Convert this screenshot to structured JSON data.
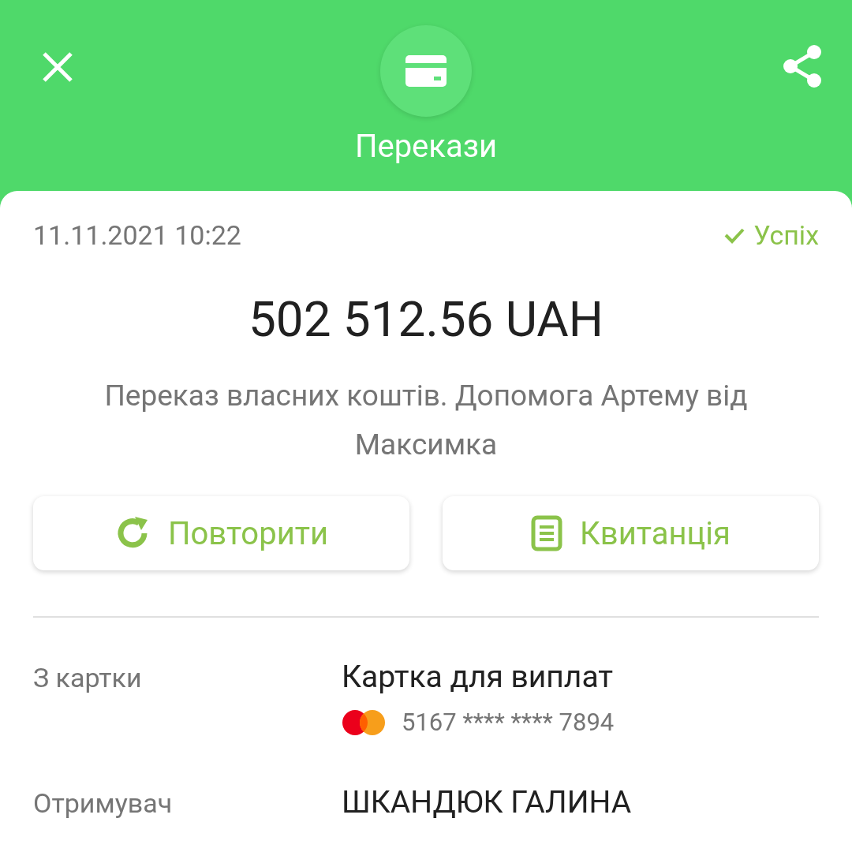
{
  "header": {
    "title": "Перекази"
  },
  "transaction": {
    "datetime": "11.11.2021 10:22",
    "status": {
      "kind": "success",
      "label": "Успіх"
    },
    "amount": "502 512.56 UAH",
    "description": "Переказ власних коштів. Допомога Артему від Максимка"
  },
  "actions": [
    {
      "kind": "repeat",
      "label": "Повторити"
    },
    {
      "kind": "receipt",
      "label": "Квитанція"
    }
  ],
  "details": [
    {
      "label": "З картки",
      "value": "Картка для виплат",
      "card_number": "5167 **** **** 7894"
    },
    {
      "label": "Отримувач",
      "value": "ШКАНДЮК ГАЛИНА"
    }
  ]
}
